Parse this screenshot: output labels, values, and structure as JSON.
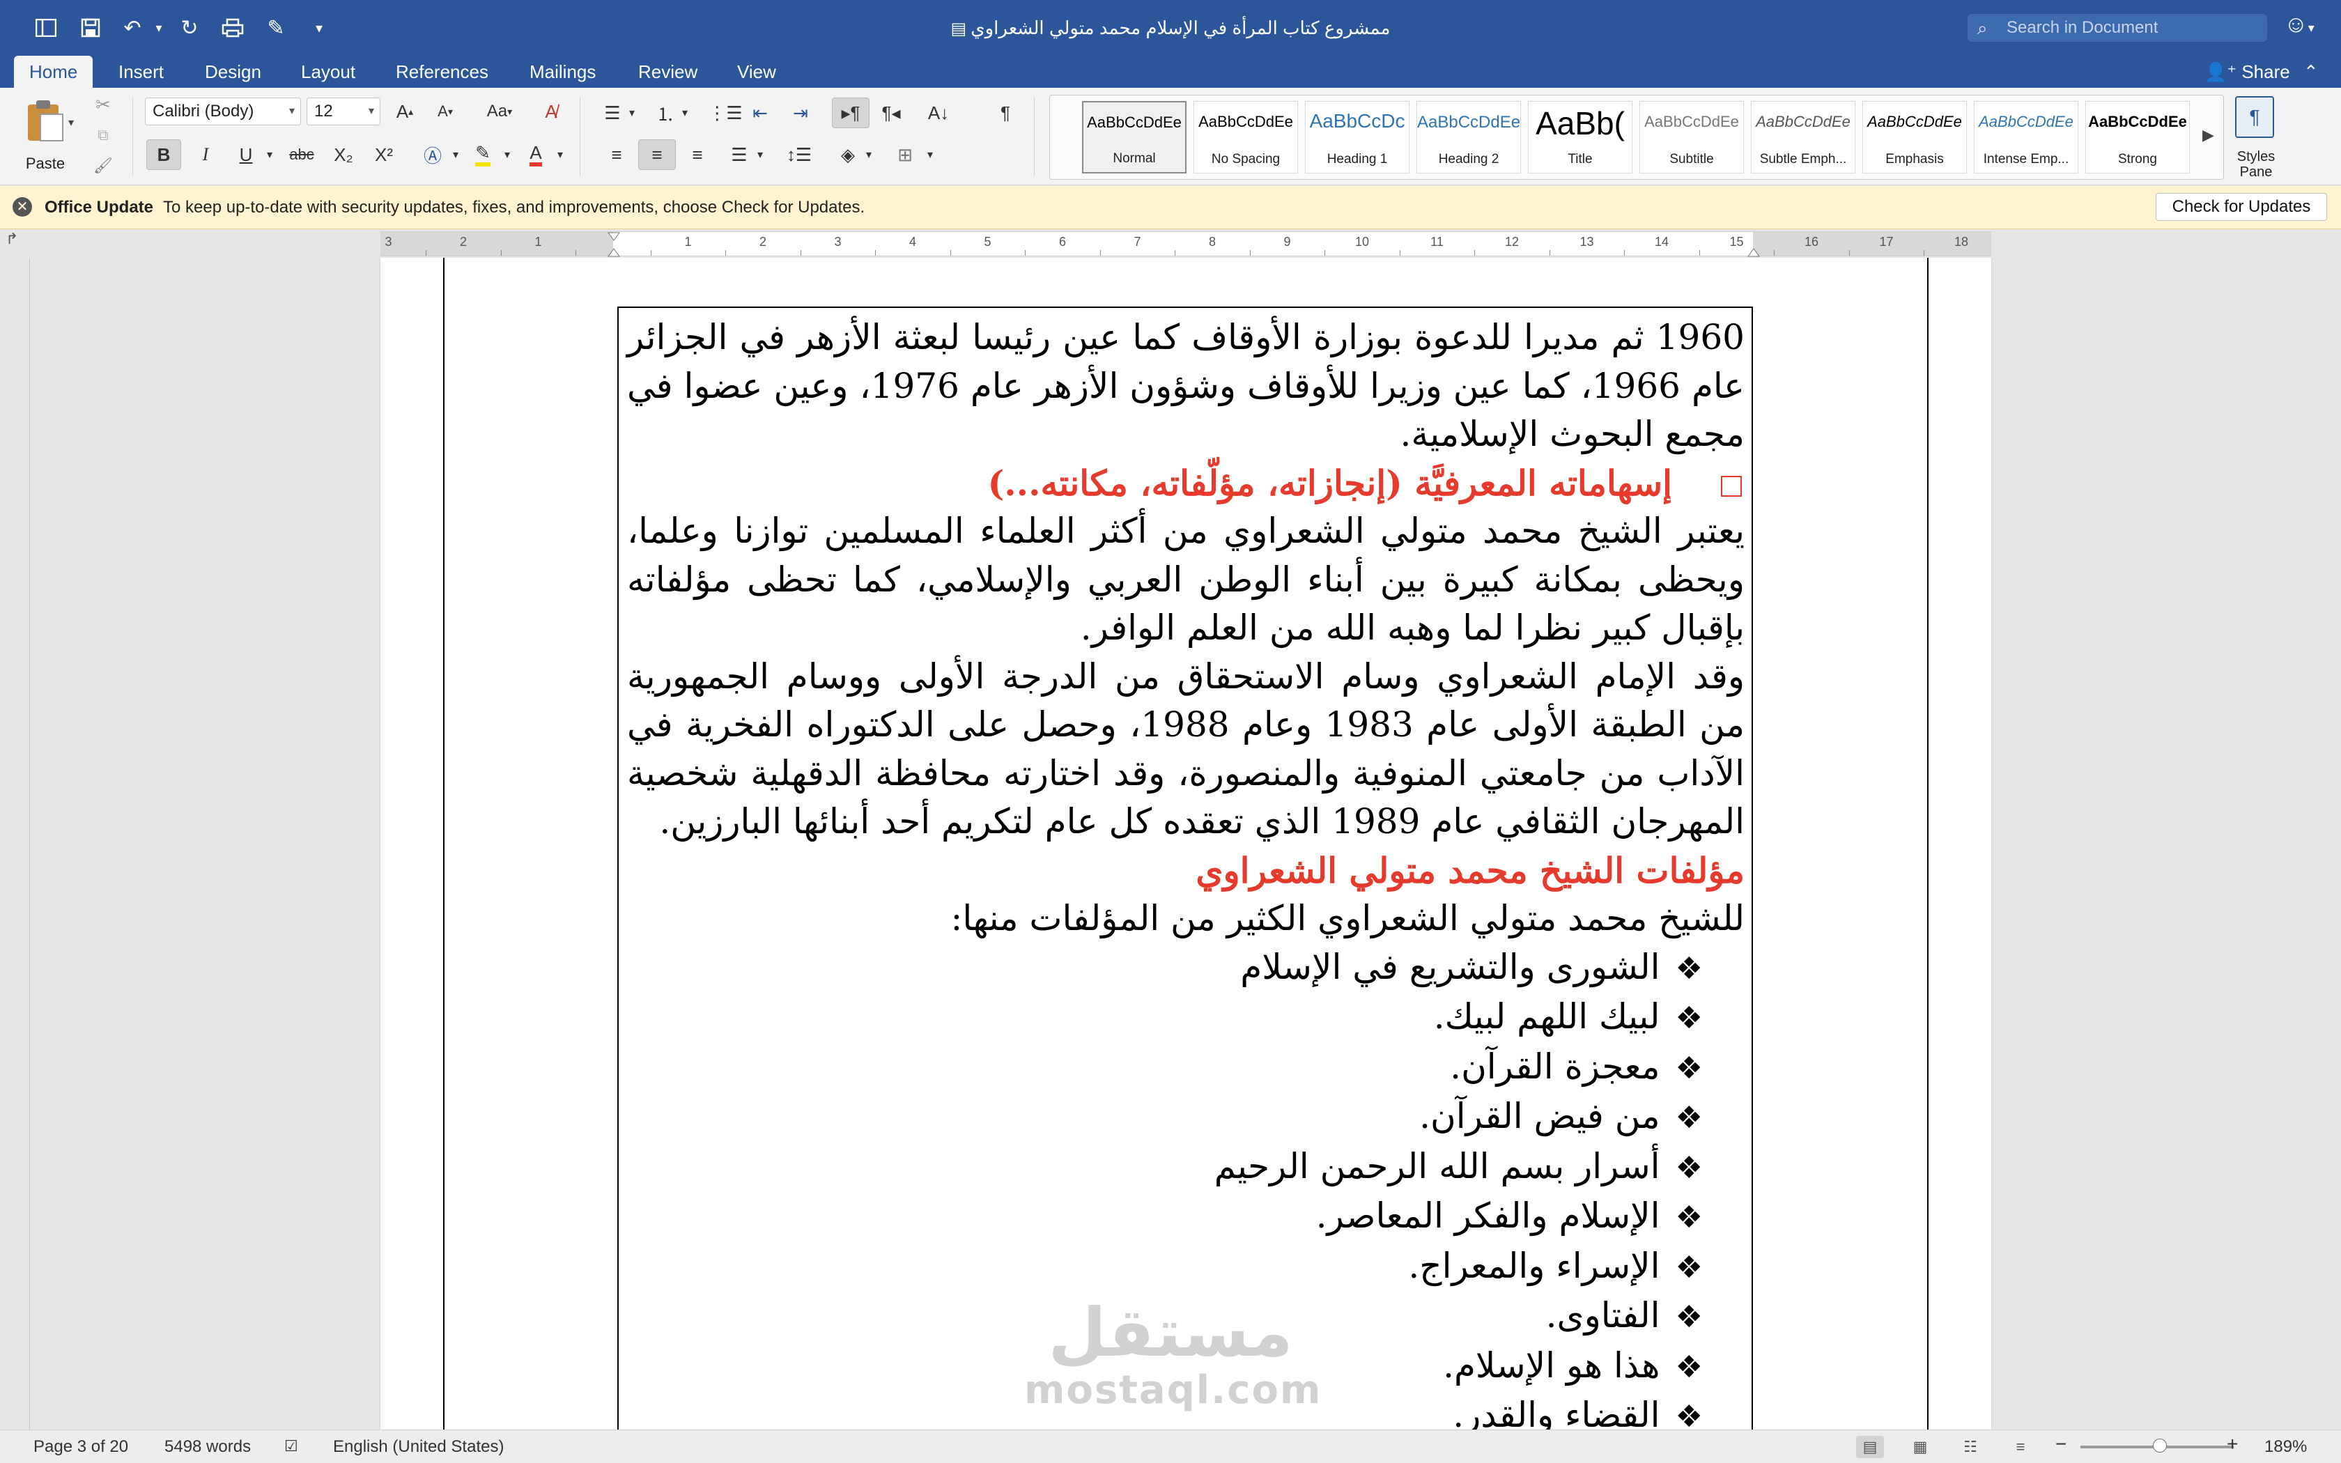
{
  "window": {
    "title": "ممشروع كتاب المرأة في الإسلام محمد متولي الشعراوي",
    "search_placeholder": "Search in Document"
  },
  "quick_access": [
    "sidebar-toggle-icon",
    "save-icon",
    "undo-icon",
    "redo-icon",
    "print-icon",
    "edit-icon",
    "customize-icon"
  ],
  "tabs": [
    {
      "label": "Home",
      "active": true
    },
    {
      "label": "Insert"
    },
    {
      "label": "Design"
    },
    {
      "label": "Layout"
    },
    {
      "label": "References"
    },
    {
      "label": "Mailings"
    },
    {
      "label": "Review"
    },
    {
      "label": "View"
    }
  ],
  "share_label": "Share",
  "ribbon": {
    "paste_label": "Paste",
    "font_name": "Calibri (Body)",
    "font_size": "12",
    "bold_label": "B",
    "italic_label": "I",
    "underline_label": "U",
    "strike_label": "abc",
    "subscript_label": "X₂",
    "superscript_label": "X²",
    "styles": [
      {
        "sample": "AaBbCcDdEe",
        "name": "Normal",
        "selected": true
      },
      {
        "sample": "AaBbCcDdEe",
        "name": "No Spacing"
      },
      {
        "sample": "AaBbCcDc",
        "name": "Heading 1"
      },
      {
        "sample": "AaBbCcDdEe",
        "name": "Heading 2"
      },
      {
        "sample": "AaBb(",
        "name": "Title"
      },
      {
        "sample": "AaBbCcDdEe",
        "name": "Subtitle"
      },
      {
        "sample": "AaBbCcDdEe",
        "name": "Subtle Emph..."
      },
      {
        "sample": "AaBbCcDdEe",
        "name": "Emphasis"
      },
      {
        "sample": "AaBbCcDdEe",
        "name": "Intense Emp..."
      },
      {
        "sample": "AaBbCcDdEe",
        "name": "Strong"
      }
    ],
    "styles_pane_label": "Styles Pane"
  },
  "update_bar": {
    "title": "Office Update",
    "message": "To keep up-to-date with security updates, fixes, and improvements, choose Check for Updates.",
    "button": "Check for Updates"
  },
  "ruler_numbers": [
    "3",
    "2",
    "1",
    "1",
    "2",
    "3",
    "4",
    "5",
    "6",
    "7",
    "8",
    "9",
    "10",
    "11",
    "12",
    "13",
    "14",
    "15",
    "16",
    "17",
    "18"
  ],
  "document": {
    "para1": "1960 ثم مديرا للدعوة بوزارة الأوقاف كما عين رئيسا لبعثة الأزهر في الجزائر عام 1966، كما عين وزيرا للأوقاف وشؤون الأزهر عام 1976، وعين عضوا في مجمع البحوث الإسلامية.",
    "heading1": "إسهاماته المعرفيَّة (إنجازاته، مؤلّفاته، مكانته...)",
    "para2": "يعتبر الشيخ محمد متولي الشعراوي من أكثر العلماء المسلمين توازنا وعلما، ويحظى بمكانة كبيرة بين أبناء الوطن العربي والإسلامي، كما تحظى مؤلفاته بإقبال كبير نظرا لما وهبه الله من العلم الوافر.",
    "para3": "وقد  الإمام الشعراوي وسام الاستحقاق من الدرجة الأولى ووسام الجمهورية من الطبقة الأولى عام 1983 وعام 1988، وحصل على الدكتوراه الفخرية في الآداب من جامعتي المنوفية والمنصورة، وقد اختارته محافظة الدقهلية شخصية المهرجان الثقافي عام 1989 الذي تعقده كل عام لتكريم أحد أبنائها البارزين.",
    "heading2": "مؤلفات الشيخ محمد متولي الشعراوي",
    "intro": "للشيخ محمد متولي الشعراوي الكثير من المؤلفات منها:",
    "list_bullet": "❖",
    "list": [
      "الشورى والتشريع في الإسلام",
      "لبيك اللهم لبيك.",
      "معجزة القرآن.",
      "من فيض القرآن.",
      "أسرار بسم الله الرحمن الرحيم",
      "الإسلام والفكر المعاصر.",
      "الإسراء والمعراج.",
      "الفتاوى.",
      "هذا هو الإسلام.",
      "القضاء والقدر."
    ]
  },
  "watermark": {
    "arabic": "مستقل",
    "latin": "mostaql.com"
  },
  "status_bar": {
    "page": "Page 3 of 20",
    "words": "5498 words",
    "language": "English (United States)",
    "zoom": "189%",
    "zoom_minus": "−",
    "zoom_plus": "+"
  },
  "colors": {
    "brand": "#2b579a",
    "heading_red": "#e53a2c",
    "update_bar_bg": "#fff4cf"
  }
}
